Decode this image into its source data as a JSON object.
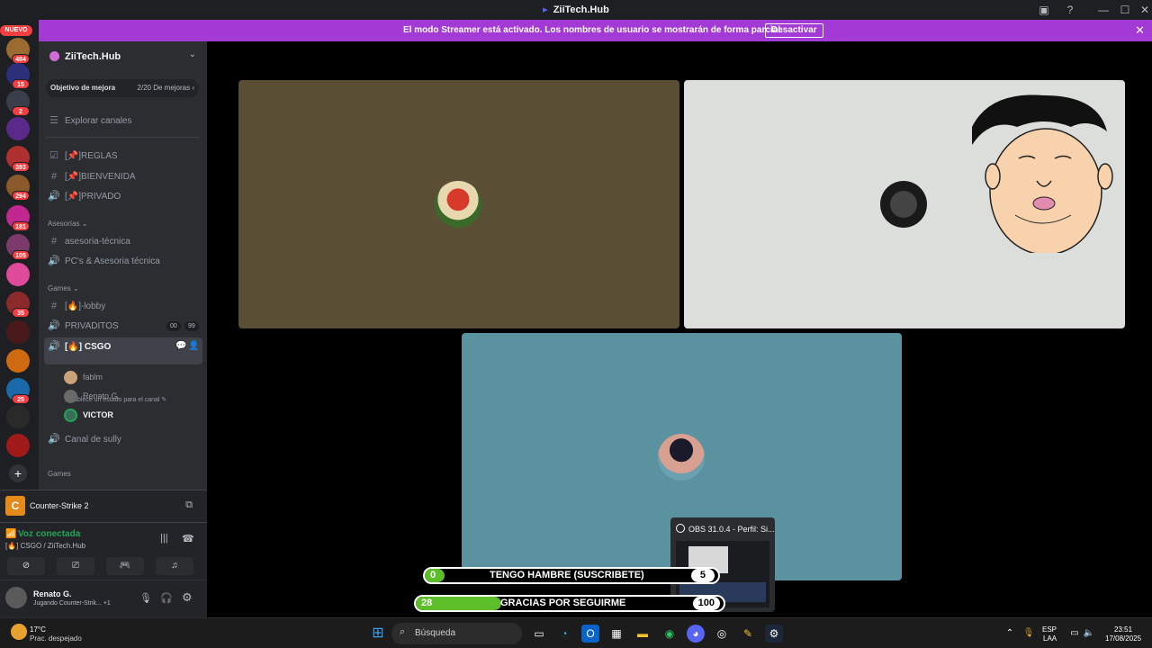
{
  "window": {
    "title": "ZiiTech.Hub"
  },
  "banner": {
    "message": "El modo Streamer está activado. Los nombres de usuario se mostrarán de forma parcial.",
    "button": "Desactivar"
  },
  "servers": {
    "new_label": "NUEVO",
    "badges": [
      "484",
      "15",
      "2",
      "393",
      "294",
      "181",
      "105",
      "35",
      "25"
    ]
  },
  "guild": {
    "name": "ZiiTech.Hub",
    "boost_label": "Objetivo de mejora",
    "boost_progress": "2/20 De mejoras",
    "explore": "Explorar canales"
  },
  "channels": {
    "reglas": "[📌]REGLAS",
    "bienvenida": "[📌]BIENVENIDA",
    "privado": "[📌]PRIVADO",
    "cat_asesorias": "Asesorías ⌄",
    "asesoria": "asesoria-técnica",
    "pcs": "PC's & Asesoria técnica",
    "cat_games": "Games ⌄",
    "lobby": "[🔥]-lobby",
    "privaditos": "PRIVADITOS",
    "privaditos_pill1": "00",
    "privaditos_pill2": "99",
    "csgo": "[🔥] CSGO",
    "csgo_status": "Establece un estado para el canal",
    "users": [
      "fablm",
      "Renato G.",
      "VICTOR"
    ],
    "sully": "Canal de sully",
    "cat_games2": "Games"
  },
  "activity": {
    "game": "Counter-Strike 2"
  },
  "voice": {
    "status": "Voz conectada",
    "channel": "[🔥] CSGO / ZiiTech.Hub"
  },
  "user": {
    "name": "Renato G.",
    "status": "Jugando Counter-Strik... +1"
  },
  "overlay": {
    "bar1": {
      "count": "0",
      "label": "TENGO HAMBRE (SUSCRIBETE)",
      "goal": "5",
      "progress": 0.0
    },
    "bar2": {
      "count": "28",
      "label": "GRACIAS POR SEGUIRME",
      "goal": "100",
      "progress": 0.28
    }
  },
  "obs_preview": {
    "title": "OBS 31.0.4 - Perfil: Si..."
  },
  "taskbar": {
    "weather_temp": "17°C",
    "weather_desc": "Prac. despejado",
    "search": "Búsqueda",
    "lang1": "ESP",
    "lang2": "LAA",
    "time": "23:51",
    "date": "17/08/2025"
  },
  "colors": {
    "banner": "#a33ad6",
    "tile1": "#5a4e35",
    "tile2": "#dcdedc",
    "tile3": "#5a92a0",
    "voice_green": "#23a55a"
  }
}
